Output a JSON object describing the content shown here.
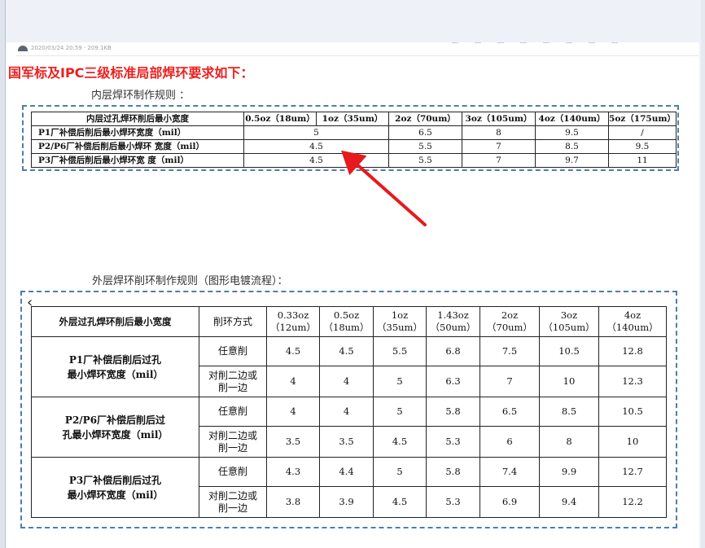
{
  "meta": {
    "timestamp": "2020/03/24 20:59 · 209.1KB"
  },
  "title": "国军标及IPC三级标准局部焊环要求如下：",
  "inner": {
    "heading": "内层焊环制作规则 ：",
    "header": [
      "内层过孔焊环削后最小宽度",
      "0.5oz（18um）",
      "1oz（35um）",
      "2oz（70um）",
      "3oz（105um）",
      "4oz（140um）",
      "5oz（175um）"
    ],
    "rows": [
      {
        "label": "P1厂补偿后削后最小焊环宽度（mil）",
        "merged": "5",
        "vals": [
          "6.5",
          "8",
          "9.5",
          "/"
        ]
      },
      {
        "label": "P2/P6厂补偿后削后最小焊环 宽度（mil）",
        "merged": "4.5",
        "vals": [
          "5.5",
          "7",
          "8.5",
          "9.5"
        ]
      },
      {
        "label": "P3厂补偿后削后最小焊环宽 度（mil）",
        "merged": "4.5",
        "vals": [
          "5.5",
          "7",
          "9.7",
          "11"
        ]
      }
    ]
  },
  "outer": {
    "heading": "外层焊环削环制作规则（图形电镀流程）：",
    "header_label": "外层过孔焊环削后最小宽度",
    "method_header": "削环方式",
    "cols": [
      [
        "0.33oz",
        "（12um）"
      ],
      [
        "0.5oz",
        "（18um）"
      ],
      [
        "1oz",
        "（35um）"
      ],
      [
        "1.43oz",
        "（50um）"
      ],
      [
        "2oz",
        "（70um）"
      ],
      [
        "3oz",
        "（105um）"
      ],
      [
        "4oz",
        "（140um）"
      ]
    ],
    "groups": [
      {
        "label": [
          "P1厂补偿后削后过孔",
          "最小焊环宽度（mil）"
        ],
        "rows": [
          {
            "method": [
              "任意削"
            ],
            "vals": [
              "4.5",
              "4.5",
              "5.5",
              "6.8",
              "7.5",
              "10.5",
              "12.8"
            ]
          },
          {
            "method": [
              "对削二边或",
              "削一边"
            ],
            "vals": [
              "4",
              "4",
              "5",
              "6.3",
              "7",
              "10",
              "12.3"
            ]
          }
        ]
      },
      {
        "label": [
          "P2/P6厂补偿后削后过",
          "孔最小焊环宽度（mil）"
        ],
        "rows": [
          {
            "method": [
              "任意削"
            ],
            "vals": [
              "4",
              "4",
              "5",
              "5.8",
              "6.5",
              "8.5",
              "10.5"
            ]
          },
          {
            "method": [
              "对削二边或",
              "削一边"
            ],
            "vals": [
              "3.5",
              "3.5",
              "4.5",
              "5.3",
              "6",
              "8",
              "10"
            ]
          }
        ]
      },
      {
        "label": [
          "P3厂补偿后削后过孔",
          "最小焊环宽度（mil）"
        ],
        "rows": [
          {
            "method": [
              "任意削"
            ],
            "vals": [
              "4.3",
              "4.4",
              "5",
              "5.8",
              "7.4",
              "9.9",
              "12.7"
            ]
          },
          {
            "method": [
              "对削二边或",
              "削一边"
            ],
            "vals": [
              "3.8",
              "3.9",
              "4.5",
              "5.3",
              "6.9",
              "9.4",
              "12.2"
            ]
          }
        ]
      }
    ]
  },
  "colors": {
    "title_red": "#ee1f1f",
    "arrow_red": "#e8191c",
    "dash_blue": "#4f7dad"
  },
  "icons": {
    "back": "chevron-left-icon",
    "avatar": "avatar-icon"
  }
}
